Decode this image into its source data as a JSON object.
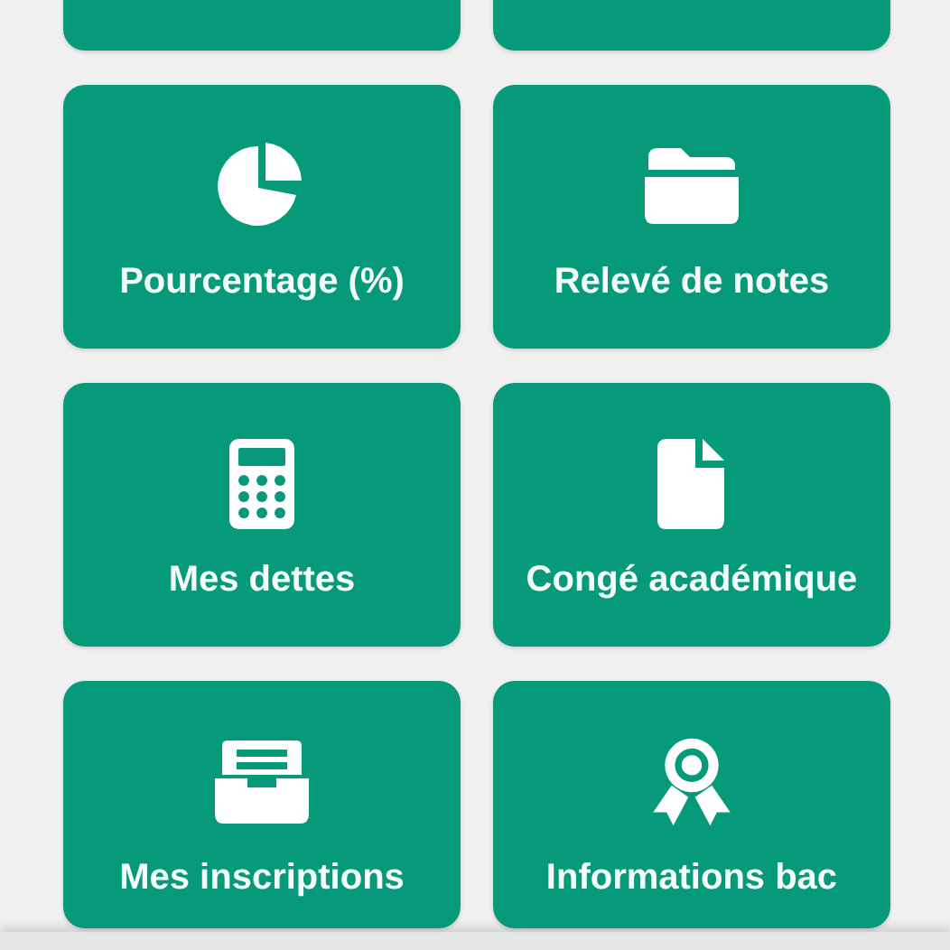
{
  "tiles": [
    {
      "label": "Pourcentage (%)"
    },
    {
      "label": "Relevé de notes"
    },
    {
      "label": "Mes dettes"
    },
    {
      "label": "Congé académique"
    },
    {
      "label": "Mes inscriptions"
    },
    {
      "label": "Informations bac"
    }
  ]
}
